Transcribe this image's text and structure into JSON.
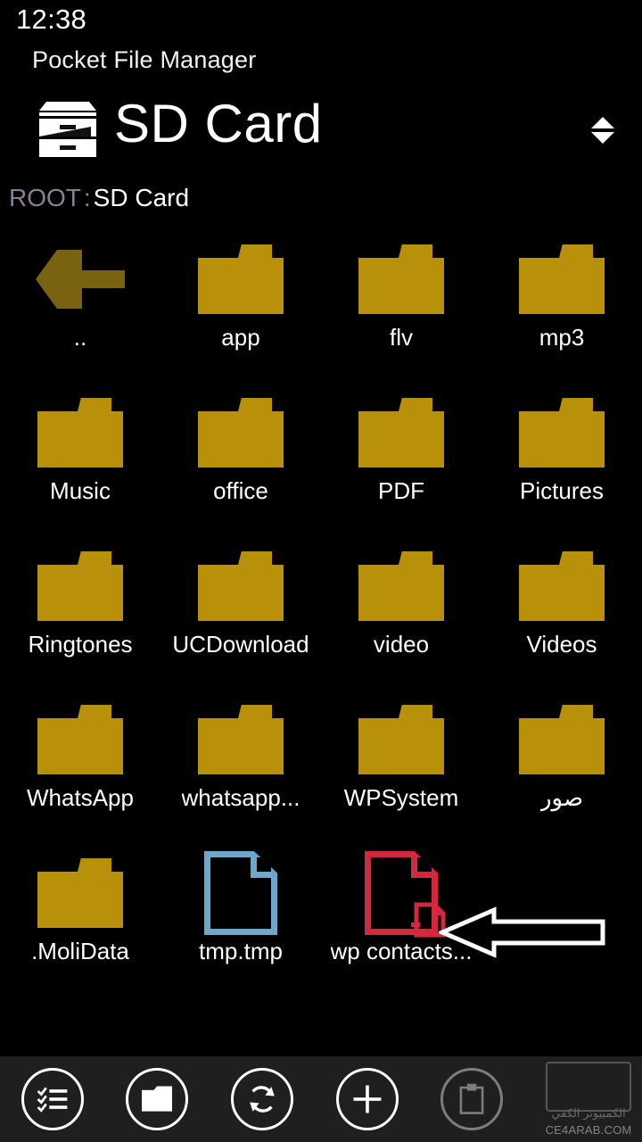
{
  "status_bar": {
    "clock": "12:38"
  },
  "app": {
    "title": "Pocket File Manager"
  },
  "header": {
    "title": "SD Card",
    "drive_icon": "file-cabinet-icon",
    "sort_icon": "sort-updown-icon"
  },
  "breadcrumb": {
    "root_label": "ROOT",
    "separator": ":",
    "current_label": "SD Card",
    "root_color": "#8d7f93",
    "current_color": "#ffffff"
  },
  "colors": {
    "background": "#000000",
    "folder": "#b8900a",
    "back_arrow": "#7a6310",
    "doc_blue": "#6ba9cc",
    "doc_red": "#d5283c",
    "appbar": "#1f1f1f",
    "disabled": "#7d7d7d"
  },
  "grid": {
    "items": [
      {
        "label": "..",
        "icon": "back-arrow-icon",
        "type": "parent"
      },
      {
        "label": "app",
        "icon": "folder-icon",
        "type": "folder"
      },
      {
        "label": "flv",
        "icon": "folder-icon",
        "type": "folder"
      },
      {
        "label": "mp3",
        "icon": "folder-icon",
        "type": "folder"
      },
      {
        "label": "Music",
        "icon": "folder-icon",
        "type": "folder"
      },
      {
        "label": "office",
        "icon": "folder-icon",
        "type": "folder"
      },
      {
        "label": "PDF",
        "icon": "folder-icon",
        "type": "folder"
      },
      {
        "label": "Pictures",
        "icon": "folder-icon",
        "type": "folder"
      },
      {
        "label": "Ringtones",
        "icon": "folder-icon",
        "type": "folder"
      },
      {
        "label": "UCDownload",
        "icon": "folder-icon",
        "type": "folder"
      },
      {
        "label": "video",
        "icon": "folder-icon",
        "type": "folder"
      },
      {
        "label": "Videos",
        "icon": "folder-icon",
        "type": "folder"
      },
      {
        "label": "WhatsApp",
        "icon": "folder-icon",
        "type": "folder"
      },
      {
        "label": "whatsapp...",
        "icon": "folder-icon",
        "type": "folder"
      },
      {
        "label": "WPSystem",
        "icon": "folder-icon",
        "type": "folder"
      },
      {
        "label": "صور",
        "icon": "folder-icon",
        "type": "folder"
      },
      {
        "label": ".MoliData",
        "icon": "folder-icon",
        "type": "folder"
      },
      {
        "label": "tmp.tmp",
        "icon": "document-blue-icon",
        "type": "file"
      },
      {
        "label": "wp contacts...",
        "icon": "document-red-icon",
        "type": "file"
      }
    ]
  },
  "annotation": {
    "arrow": "left-pointing-arrow-annotation"
  },
  "appbar": {
    "buttons": [
      {
        "label": "Select",
        "icon": "checklist-icon",
        "enabled": true
      },
      {
        "label": "Folder",
        "icon": "folder-icon",
        "enabled": true
      },
      {
        "label": "Refresh",
        "icon": "refresh-icon",
        "enabled": true
      },
      {
        "label": "Add",
        "icon": "plus-icon",
        "enabled": true
      },
      {
        "label": "Paste",
        "icon": "clipboard-icon",
        "enabled": false
      }
    ]
  },
  "watermark": {
    "arabic": "الكمبيوتر الكفي",
    "url": "CE4ARAB.COM"
  }
}
